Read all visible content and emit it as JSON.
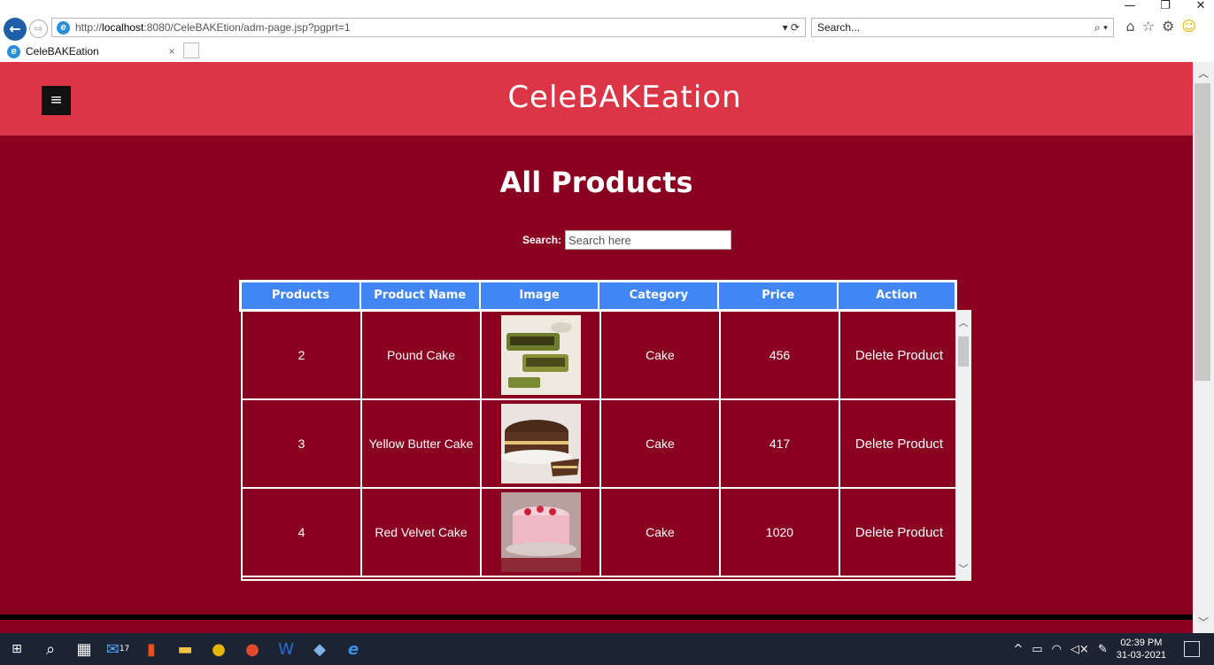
{
  "window": {
    "min_glyph": "—",
    "restore_glyph": "❐",
    "close_glyph": "✕"
  },
  "browser": {
    "address_url_prefix": "http://",
    "address_host": "localhost",
    "address_path": ":8080/CeleBAKEtion/adm-page.jsp?pgprt=1",
    "address_controls": "▾ ⟳",
    "search_placeholder": "Search...",
    "search_glyph": "⌕ ▾",
    "tab_title": "CeleBAKEation",
    "tab_close": "×",
    "toolbar_icons": [
      "home-icon",
      "star-icon",
      "gear-icon",
      "smiley-icon"
    ]
  },
  "site": {
    "brand": "CeleBAKEation",
    "menu_glyph": "≡"
  },
  "page": {
    "title": "All Products",
    "search_label": "Search:",
    "search_placeholder": "Search here"
  },
  "table": {
    "headers": [
      "Products",
      "Product Name",
      "Image",
      "Category",
      "Price",
      "Action"
    ],
    "rows": [
      {
        "id": "2",
        "name": "Pound Cake",
        "category": "Cake",
        "price": "456",
        "action": "Delete Product",
        "image_icon": "pound-cake-image"
      },
      {
        "id": "3",
        "name": "Yellow Butter Cake",
        "category": "Cake",
        "price": "417",
        "action": "Delete Product",
        "image_icon": "chocolate-cake-image"
      },
      {
        "id": "4",
        "name": "Red Velvet Cake",
        "category": "Cake",
        "price": "1020",
        "action": "Delete Product",
        "image_icon": "red-velvet-cake-image"
      }
    ]
  },
  "taskbar": {
    "icons": [
      "windows-start-icon",
      "search-icon",
      "calculator-icon",
      "mail-icon",
      "office-icon",
      "file-explorer-icon",
      "chrome-icon",
      "chrome-profile-icon",
      "word-icon",
      "package-icon",
      "edge-icon"
    ],
    "mail_badge": "17",
    "clock_time": "02:39 PM",
    "clock_date": "31-03-2021"
  },
  "colors": {
    "header": "#dc3545",
    "page_bg": "#8a0020",
    "table_header": "#4285f4",
    "taskbar": "#1c2433"
  }
}
